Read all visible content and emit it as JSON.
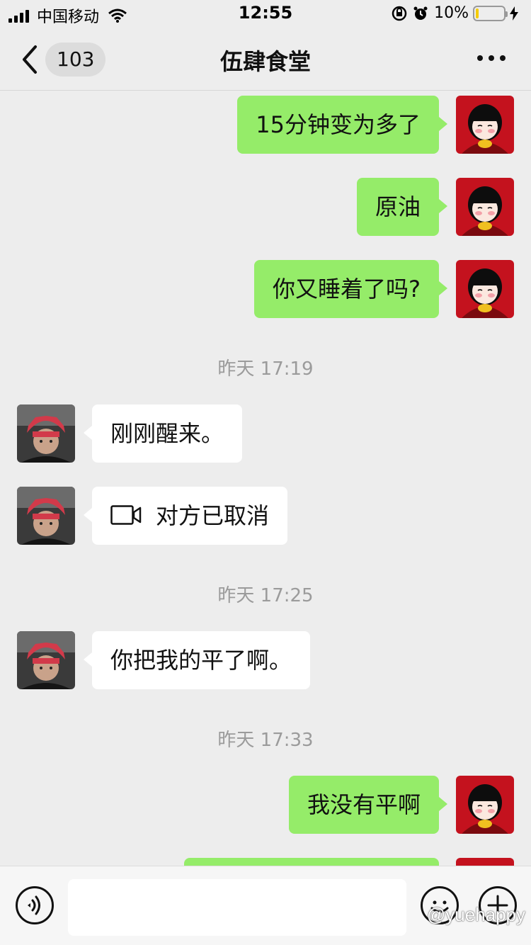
{
  "status_bar": {
    "carrier": "中国移动",
    "time": "12:55",
    "battery_percent": "10%",
    "battery_level": 0.1
  },
  "nav": {
    "unread_count": "103",
    "title": "伍肆食堂",
    "icons": {
      "back": "chevron-left-icon",
      "more": "more-icon"
    }
  },
  "messages": [
    {
      "side": "right",
      "text": "15分钟变为多了"
    },
    {
      "side": "right",
      "text": "原油"
    },
    {
      "side": "right",
      "text": "你又睡着了吗?"
    },
    {
      "type": "time",
      "text": "昨天 17:19"
    },
    {
      "side": "left",
      "text": "刚刚醒来。"
    },
    {
      "side": "left",
      "text": "对方已取消",
      "icon": "video-call-icon"
    },
    {
      "type": "time",
      "text": "昨天 17:25"
    },
    {
      "side": "left",
      "text": "你把我的平了啊。"
    },
    {
      "type": "time",
      "text": "昨天 17:33"
    },
    {
      "side": "right",
      "text": "我没有平啊"
    }
  ],
  "input_bar": {
    "icons": {
      "voice": "voice-icon",
      "emoji": "emoji-icon",
      "plus": "plus-icon"
    }
  },
  "watermark": "@yuehappy",
  "colors": {
    "sent_bubble": "#95ec69",
    "received_bubble": "#ffffff",
    "background": "#ededed"
  }
}
